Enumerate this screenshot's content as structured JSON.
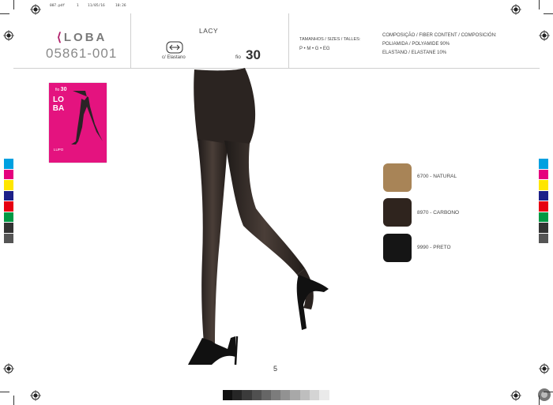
{
  "slug": {
    "file": "007.pdf",
    "page": "1",
    "date": "11/05/16",
    "time": "10:26"
  },
  "header": {
    "brand": "LOBA",
    "model_code": "05861-001",
    "product_name": "LACY",
    "elastane_label": "c/ Elastano",
    "fio_label": "fio",
    "fio_value": "30",
    "sizes_label": "TAMANHOS / SIZES / TALLES:",
    "sizes_values": "P • M • G • EG",
    "composition_title": "COMPOSIÇÃO / FIBER CONTENT / COMPOSICIÓN:",
    "composition_line1": "POLIAMIDA / POLYAMIDE 90%",
    "composition_line2": "ELASTANO / ELASTANE 10%"
  },
  "package": {
    "fio": "fio",
    "fio_value": "30",
    "logo": "LOBA",
    "line_name": "LUPO"
  },
  "swatches": [
    {
      "label": "6700 - NATURAL",
      "color": "#a88457"
    },
    {
      "label": "8970 - CARBONO",
      "color": "#2f241e"
    },
    {
      "label": "9990 - PRETO",
      "color": "#151515"
    }
  ],
  "page_number": "5",
  "colors": {
    "brand_pink": "#e4137f",
    "header_rule": "#cfcfcf"
  },
  "color_bar": [
    "#00a0e0",
    "#e5007e",
    "#ffe600",
    "#1d2088",
    "#e60012",
    "#009944",
    "#333333",
    "#555555"
  ],
  "gray_ramp": [
    "#111111",
    "#262626",
    "#3b3b3b",
    "#505050",
    "#666666",
    "#7c7c7c",
    "#929292",
    "#a8a8a8",
    "#bebebe",
    "#d4d4d4",
    "#eaeaea"
  ]
}
